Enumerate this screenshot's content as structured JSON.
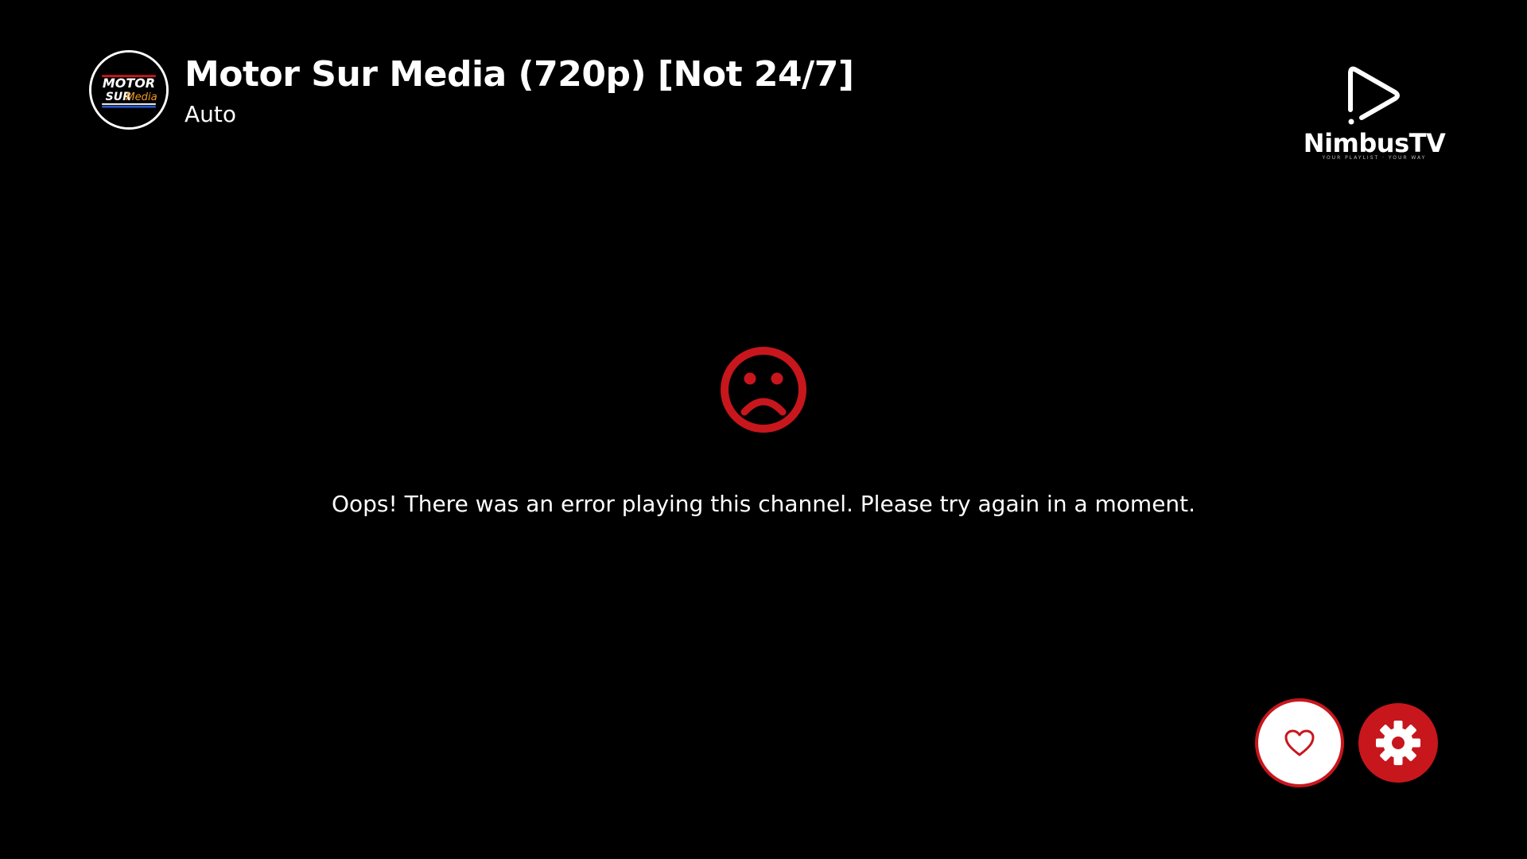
{
  "channel": {
    "title": "Motor Sur Media (720p) [Not 24/7]",
    "category": "Auto",
    "logo": {
      "line1": "MOTOR",
      "line2a": "SUR",
      "line2b": "Media"
    }
  },
  "brand": {
    "name": "NimbusTV",
    "tagline": "YOUR PLAYLIST · YOUR WAY",
    "icon": "play-outline-icon"
  },
  "error": {
    "icon": "sad-face-icon",
    "message": "Oops! There was an error playing this channel. Please try again in a moment."
  },
  "actions": {
    "favorite_icon": "heart-outline-icon",
    "settings_icon": "gear-icon"
  },
  "colors": {
    "background": "#000000",
    "accent": "#c8161d",
    "text": "#ffffff"
  }
}
